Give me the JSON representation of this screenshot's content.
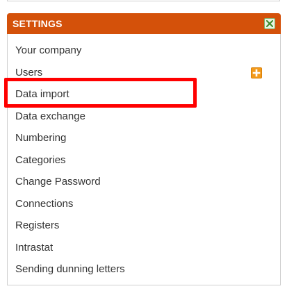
{
  "settings_panel": {
    "title": "SETTINGS",
    "close_icon": "close-icon",
    "add_icon": "plus-icon",
    "header_color": "#d4510a",
    "highlight_color": "#ff0000",
    "items": [
      {
        "label": "Your company"
      },
      {
        "label": "Users"
      },
      {
        "label": "Data import"
      },
      {
        "label": "Data exchange"
      },
      {
        "label": "Numbering"
      },
      {
        "label": "Categories"
      },
      {
        "label": "Change Password"
      },
      {
        "label": "Connections"
      },
      {
        "label": "Registers"
      },
      {
        "label": "Intrastat"
      },
      {
        "label": "Sending dunning letters"
      }
    ]
  }
}
